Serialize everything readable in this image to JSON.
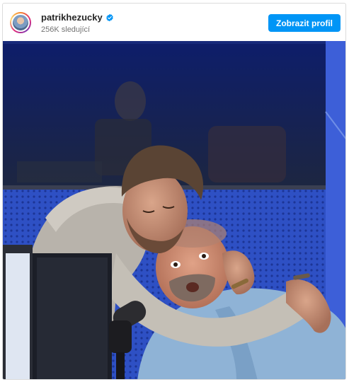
{
  "header": {
    "username": "patrikhezucky",
    "followers": "256K sledující",
    "profile_button": "Zobrazit profil",
    "verified_icon": "verified-badge-icon"
  },
  "post": {
    "image_icon": "studio-photo",
    "colors": {
      "accent": "#0095f6",
      "studio_wall": "#2f52c9",
      "window": "#1a2548"
    }
  }
}
